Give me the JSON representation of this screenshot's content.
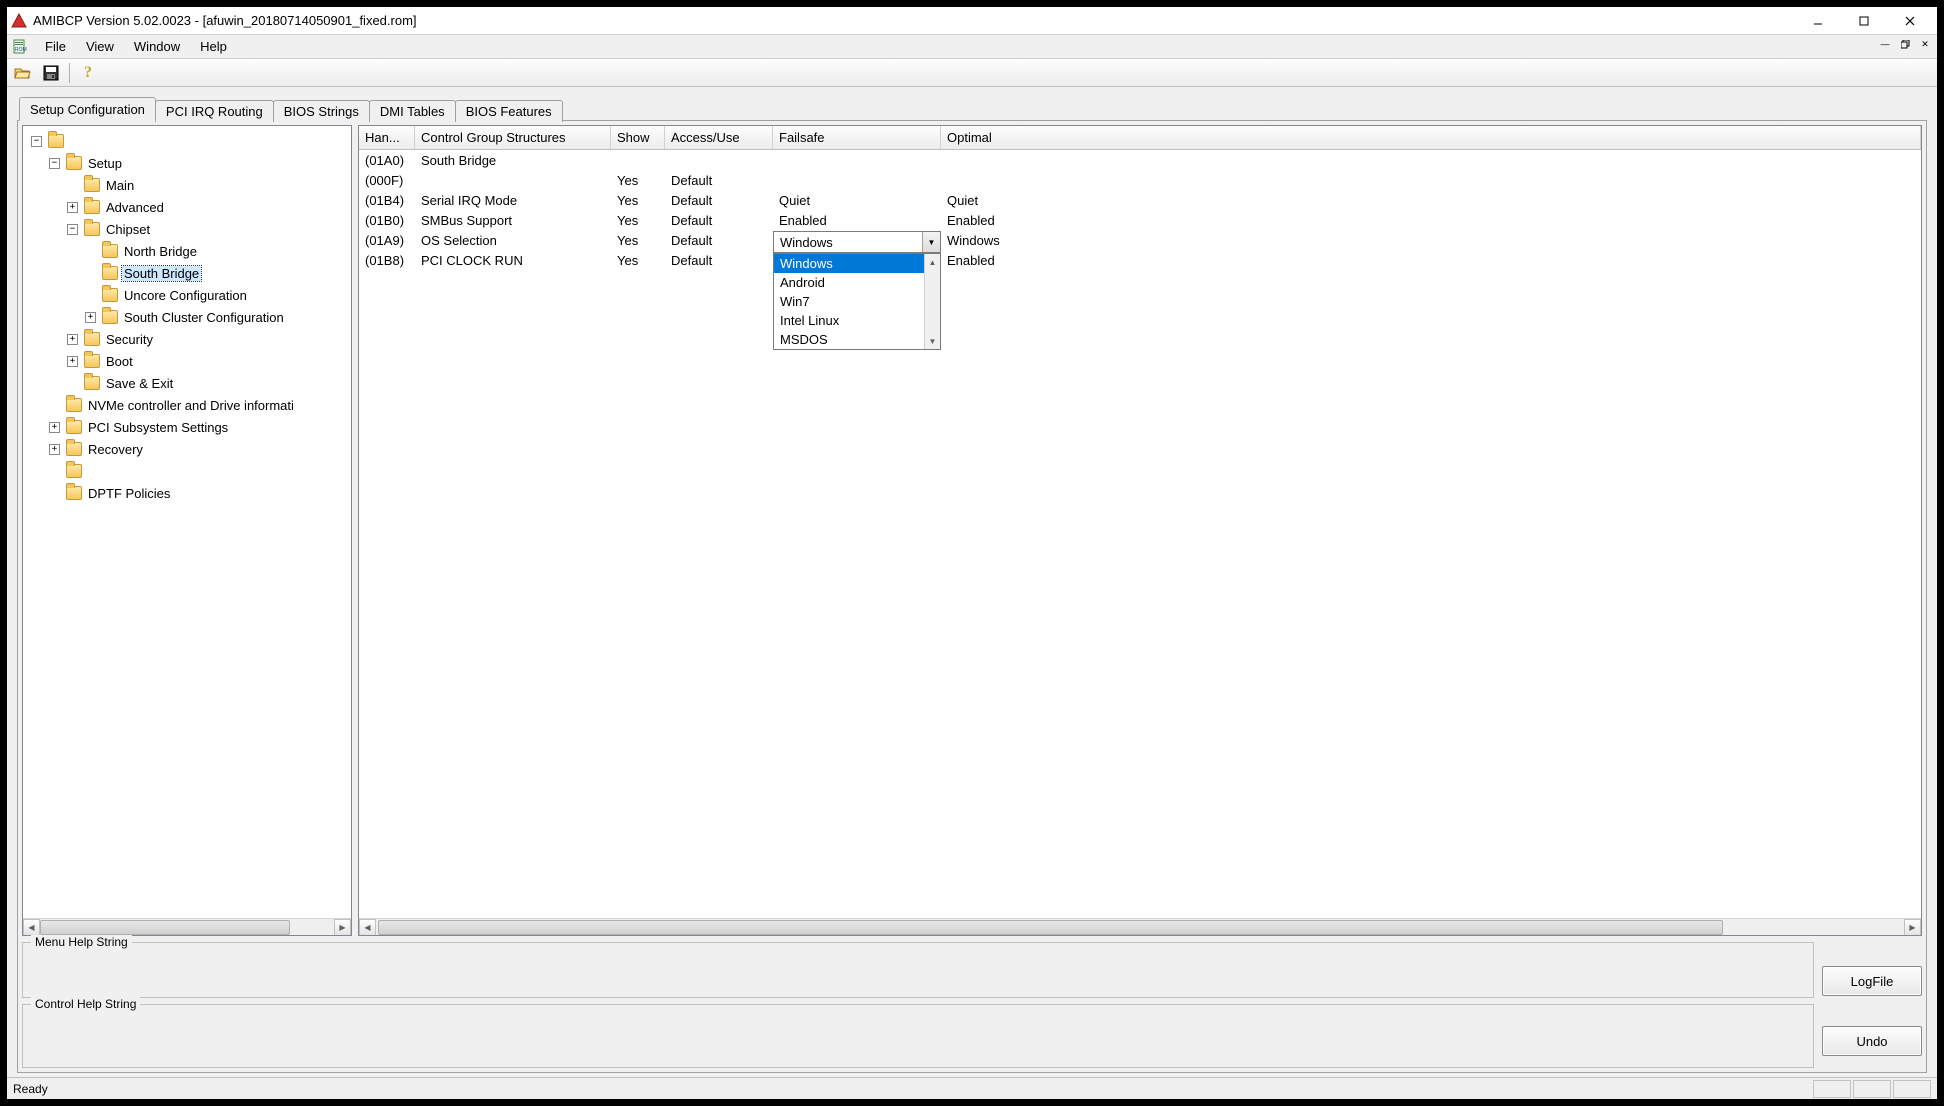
{
  "window": {
    "title": "AMIBCP Version 5.02.0023 - [afuwin_20180714050901_fixed.rom]"
  },
  "menu": {
    "items": [
      "File",
      "View",
      "Window",
      "Help"
    ]
  },
  "tabs": [
    "Setup Configuration",
    "PCI IRQ Routing",
    "BIOS Strings",
    "DMI Tables",
    "BIOS Features"
  ],
  "tree": {
    "root_blank": "",
    "setup": "Setup",
    "main": "Main",
    "advanced": "Advanced",
    "chipset": "Chipset",
    "north_bridge": "North Bridge",
    "south_bridge": "South Bridge",
    "uncore": "Uncore Configuration",
    "south_cluster": "South Cluster Configuration",
    "security": "Security",
    "boot": "Boot",
    "save_exit": "Save & Exit",
    "nvme": "NVMe controller and Drive informati",
    "pci_sub": "PCI Subsystem Settings",
    "recovery": "Recovery",
    "blank2": "",
    "dptf": "DPTF Policies"
  },
  "grid": {
    "headers": {
      "han": "Han...",
      "cgs": "Control Group Structures",
      "show": "Show",
      "access": "Access/Use",
      "failsafe": "Failsafe",
      "optimal": "Optimal"
    },
    "rows": [
      {
        "han": "(01A0)",
        "cgs": "South Bridge",
        "show": "",
        "access": "",
        "failsafe": "",
        "optimal": ""
      },
      {
        "han": "(000F)",
        "cgs": "",
        "show": "Yes",
        "access": "Default",
        "failsafe": "",
        "optimal": ""
      },
      {
        "han": "(01B4)",
        "cgs": "Serial IRQ Mode",
        "show": "Yes",
        "access": "Default",
        "failsafe": "Quiet",
        "optimal": "Quiet"
      },
      {
        "han": "(01B0)",
        "cgs": "SMBus Support",
        "show": "Yes",
        "access": "Default",
        "failsafe": "Enabled",
        "optimal": "Enabled"
      },
      {
        "han": "(01A9)",
        "cgs": "OS Selection",
        "show": "Yes",
        "access": "Default",
        "failsafe": "",
        "optimal": "Windows"
      },
      {
        "han": "(01B8)",
        "cgs": "PCI CLOCK RUN",
        "show": "Yes",
        "access": "Default",
        "failsafe": "",
        "optimal": "Enabled"
      }
    ]
  },
  "combo": {
    "value": "Windows",
    "options": [
      "Windows",
      "Android",
      "Win7",
      "Intel Linux",
      "MSDOS"
    ]
  },
  "groupbox": {
    "menu_help": "Menu Help String",
    "control_help": "Control Help String"
  },
  "buttons": {
    "logfile": "LogFile",
    "undo": "Undo"
  },
  "status": {
    "text": "Ready"
  }
}
